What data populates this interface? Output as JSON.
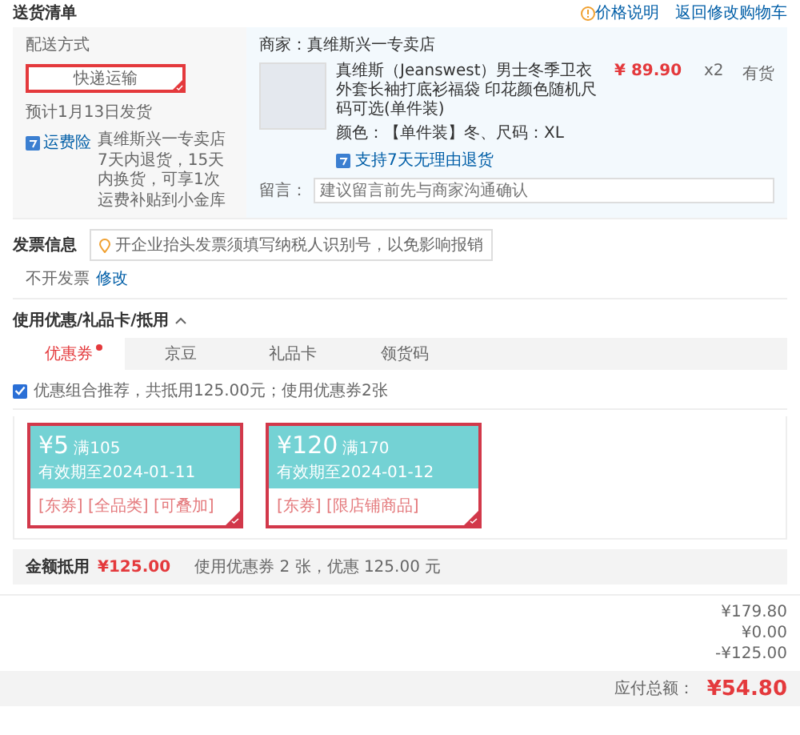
{
  "header": {
    "title": "送货清单",
    "price_note": "价格说明",
    "back_link": "返回修改购物车"
  },
  "delivery": {
    "label": "配送方式",
    "options": [
      {
        "label": "快递运输",
        "selected": true
      }
    ],
    "estimate": "预计1月13日发货",
    "service_badge": "运费险",
    "service_text": "真维斯兴一专卖店7天内退货，15天内换货，可享1次运费补贴到小金库"
  },
  "shop": {
    "seller": "商家：真维斯兴一专卖店",
    "product": {
      "title": "真维斯（Jeanswest）男士冬季卫衣外套长袖打底衫福袋 印花颜色随机尺码可选(单件装)",
      "price": "¥ 89.90",
      "quantity": "x2",
      "stock": "有货",
      "spec": "颜色：【单件装】冬、尺码：XL",
      "return_policy": "支持7天无理由退货"
    },
    "note": {
      "label": "留言：",
      "placeholder": "建议留言前先与商家沟通确认"
    }
  },
  "invoice": {
    "title": "发票信息",
    "tip": "开企业抬头发票须填写纳税人识别号，以免影响报销",
    "status": "不开发票",
    "edit_link": "修改"
  },
  "discounts": {
    "title": "使用优惠/礼品卡/抵用",
    "expanded": true,
    "tabs": [
      {
        "label": "优惠券",
        "selected": true,
        "dot": true
      },
      {
        "label": "京豆",
        "selected": false,
        "dot": false
      },
      {
        "label": "礼品卡",
        "selected": false,
        "dot": false
      },
      {
        "label": "领货码",
        "selected": false,
        "dot": false
      }
    ],
    "recommend": {
      "checked": true,
      "text": "优惠组合推荐，共抵用125.00元；使用优惠券2张"
    },
    "coupons": [
      {
        "amount": "¥5",
        "threshold": "满105",
        "expiry": "有效期至2024-01-11",
        "tags": "[东券] [全品类] [可叠加]",
        "selected": true
      },
      {
        "amount": "¥120",
        "threshold": "满170",
        "expiry": "有效期至2024-01-12",
        "tags": "[东券] [限店铺商品]",
        "selected": true
      }
    ],
    "summary_label": "金额抵用",
    "summary_amount": "¥125.00",
    "summary_text": "使用优惠券 2 张，优惠 125.00 元"
  },
  "totals": {
    "amounts": [
      "¥179.80",
      "¥0.00",
      "-¥125.00"
    ],
    "payable_label": "应付总额：",
    "payable": "¥54.80"
  }
}
